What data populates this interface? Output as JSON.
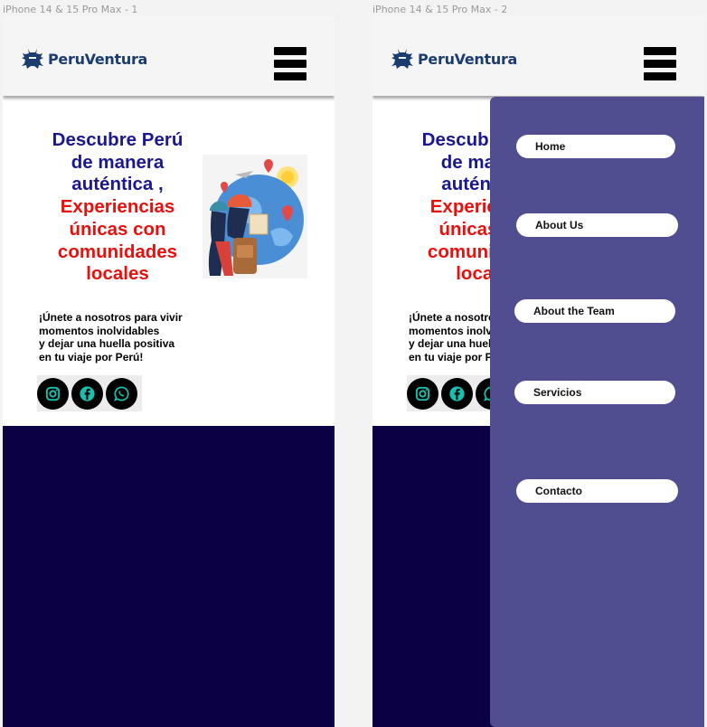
{
  "frames": [
    {
      "label": "iPhone 14 & 15 Pro Max - 1"
    },
    {
      "label": "iPhone 14 & 15 Pro Max - 2"
    }
  ],
  "brand": {
    "name": "PeruVentura",
    "icon": "llama-logo-icon",
    "color": "#1b3c6e"
  },
  "hero": {
    "title_blue": [
      "Descubre Perú",
      "de manera",
      "auténtica ,"
    ],
    "title_red": [
      "Experiencias",
      "únicas con",
      "comunidades",
      "locales"
    ],
    "subtitle": [
      "¡Únete a nosotros para vivir",
      "momentos inolvidables",
      "y dejar una huella positiva",
      "en tu viaje por Perú!"
    ],
    "image": "traveler-illustration"
  },
  "socials": [
    {
      "name": "instagram-icon"
    },
    {
      "name": "facebook-icon"
    },
    {
      "name": "whatsapp-icon"
    }
  ],
  "menu": {
    "items": [
      {
        "label": "Home"
      },
      {
        "label": "About Us"
      },
      {
        "label": "About the Team"
      },
      {
        "label": "Servicios"
      },
      {
        "label": "Contacto"
      }
    ]
  },
  "colors": {
    "title_blue": "#1a1891",
    "title_red": "#e8100d",
    "footer": "#0c0045",
    "drawer": "#504e91",
    "social_icon": "#18c0b0"
  }
}
